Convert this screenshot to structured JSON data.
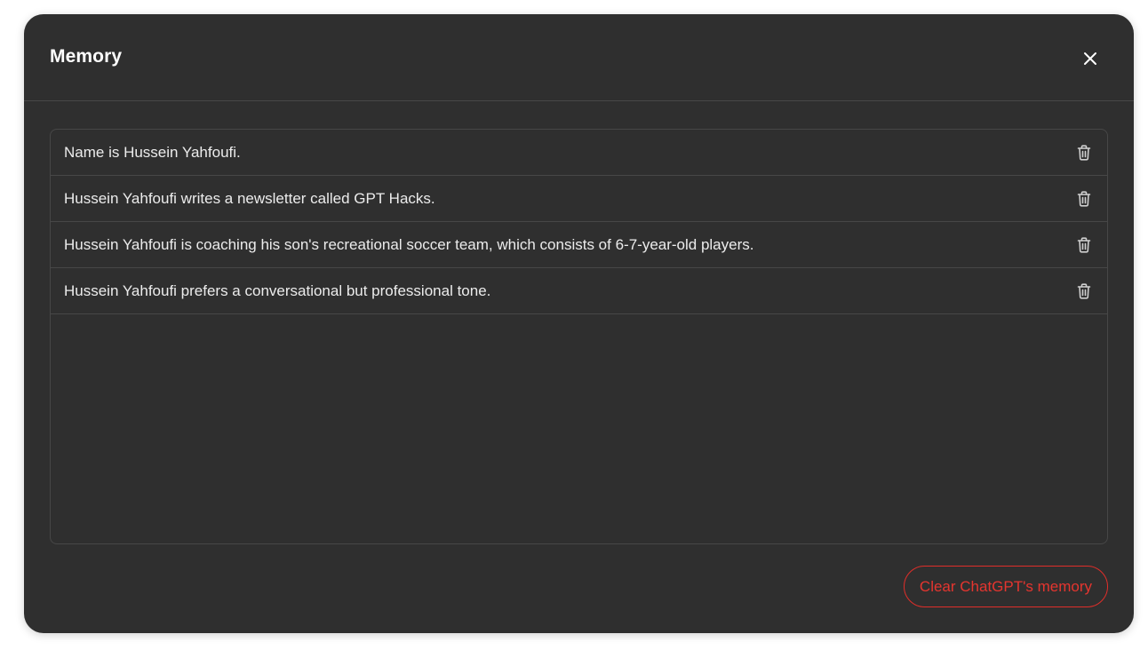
{
  "modal": {
    "title": "Memory",
    "close_icon": "close-icon"
  },
  "memories": [
    {
      "text": "Name is Hussein Yahfoufi.",
      "icon": "trash-icon"
    },
    {
      "text": "Hussein Yahfoufi writes a newsletter called GPT Hacks.",
      "icon": "trash-icon"
    },
    {
      "text": "Hussein Yahfoufi is coaching his son's recreational soccer team, which consists of 6-7-year-old players.",
      "icon": "trash-icon"
    },
    {
      "text": "Hussein Yahfoufi prefers a conversational but professional tone.",
      "icon": "trash-icon"
    }
  ],
  "footer": {
    "clear_label": "Clear ChatGPT's memory"
  },
  "colors": {
    "modal_bg": "#2f2f2f",
    "border": "#474747",
    "text": "#ececec",
    "danger": "#e02e2a",
    "page_bg": "#ffffff"
  }
}
